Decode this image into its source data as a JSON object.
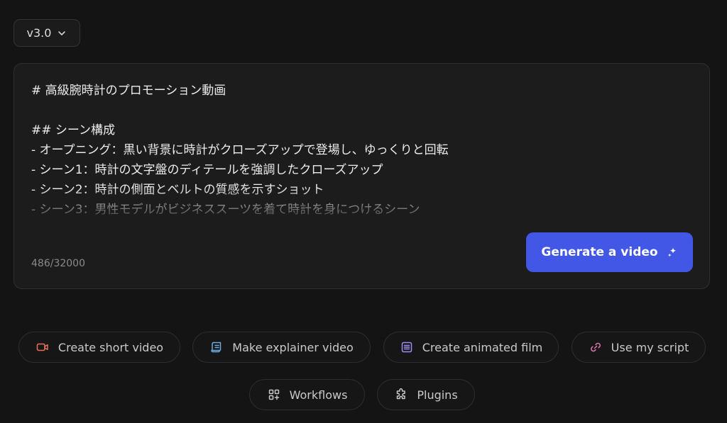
{
  "version": {
    "label": "v3.0"
  },
  "editor": {
    "lines": [
      "# 高級腕時計のプロモーション動画",
      "",
      "## シーン構成",
      "- オープニング：黒い背景に時計がクローズアップで登場し、ゆっくりと回転",
      "- シーン1：時計の文字盤のディテールを強調したクローズアップ",
      "- シーン2：時計の側面とベルトの質感を示すショット",
      "- シーン3：男性モデルがビジネススーツを着て時計を身につけるシーン"
    ],
    "char_count": "486/32000",
    "generate_label": "Generate a video"
  },
  "actions": [
    {
      "label": "Create short video",
      "icon": "video-camera-icon",
      "color": "#e8705a"
    },
    {
      "label": "Make explainer video",
      "icon": "scroll-icon",
      "color": "#6aa8e0"
    },
    {
      "label": "Create animated film",
      "icon": "document-list-icon",
      "color": "#9b8cf0"
    },
    {
      "label": "Use my script",
      "icon": "link-icon",
      "color": "#e07ab0"
    },
    {
      "label": "Workflows",
      "icon": "workflows-icon",
      "color": "#c9c9c9"
    },
    {
      "label": "Plugins",
      "icon": "puzzle-icon",
      "color": "#c9c9c9"
    }
  ]
}
